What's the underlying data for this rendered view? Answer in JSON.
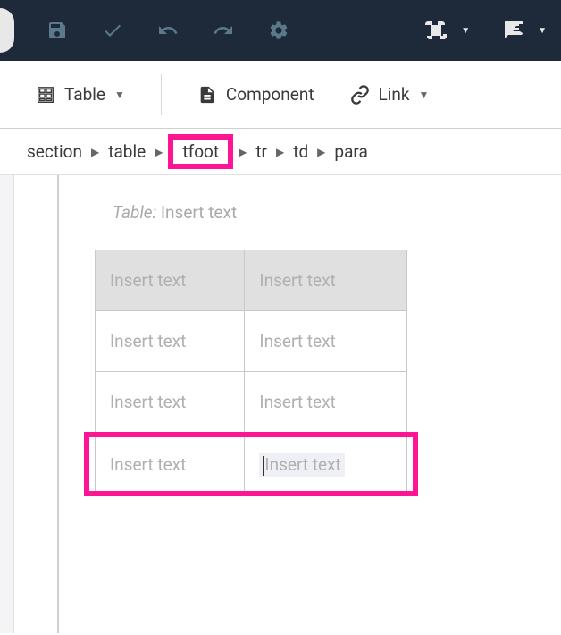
{
  "toolbar": {
    "icons": [
      "save",
      "check",
      "undo",
      "redo",
      "gear",
      "frame",
      "chat"
    ]
  },
  "menu": {
    "table": "Table",
    "component": "Component",
    "link": "Link"
  },
  "breadcrumb": {
    "items": [
      "section",
      "table",
      "tfoot",
      "tr",
      "td",
      "para"
    ],
    "highlighted_index": 2
  },
  "editor": {
    "table_prefix": "Table:",
    "table_placeholder": "Insert text",
    "cells": {
      "placeholder": "Insert text"
    }
  },
  "colors": {
    "highlight": "#ff1493",
    "toolbar_bg": "#1e2a3a"
  }
}
